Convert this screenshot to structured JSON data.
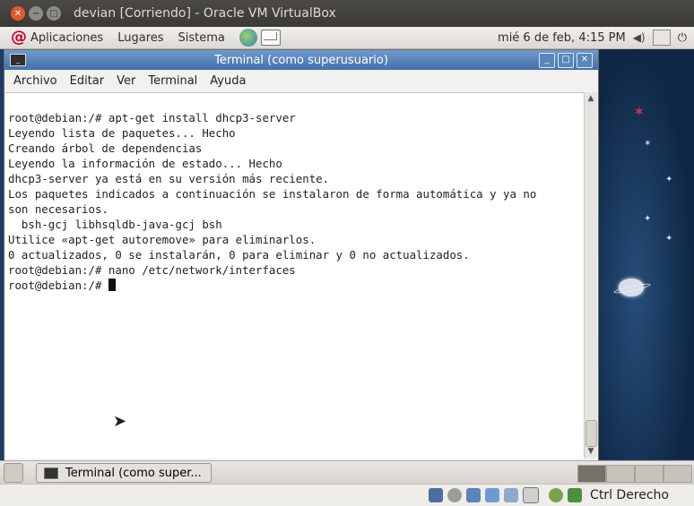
{
  "vbox": {
    "title": "devian [Corriendo] - Oracle VM VirtualBox",
    "host_key": "Ctrl Derecho"
  },
  "panel": {
    "menus": [
      "Aplicaciones",
      "Lugares",
      "Sistema"
    ],
    "datetime": "mié  6 de feb,  4:15 PM"
  },
  "terminal": {
    "title": "Terminal (como superusuario)",
    "menu": [
      "Archivo",
      "Editar",
      "Ver",
      "Terminal",
      "Ayuda"
    ],
    "lines": [
      "root@debian:/# apt-get install dhcp3-server",
      "Leyendo lista de paquetes... Hecho",
      "Creando árbol de dependencias",
      "Leyendo la información de estado... Hecho",
      "dhcp3-server ya está en su versión más reciente.",
      "Los paquetes indicados a continuación se instalaron de forma automática y ya no",
      "son necesarios.",
      "  bsh-gcj libhsqldb-java-gcj bsh",
      "Utilice «apt-get autoremove» para eliminarlos.",
      "0 actualizados, 0 se instalarán, 0 para eliminar y 0 no actualizados.",
      "root@debian:/# nano /etc/network/interfaces",
      "root@debian:/# "
    ]
  },
  "taskbar": {
    "task_label": "Terminal (como super..."
  }
}
